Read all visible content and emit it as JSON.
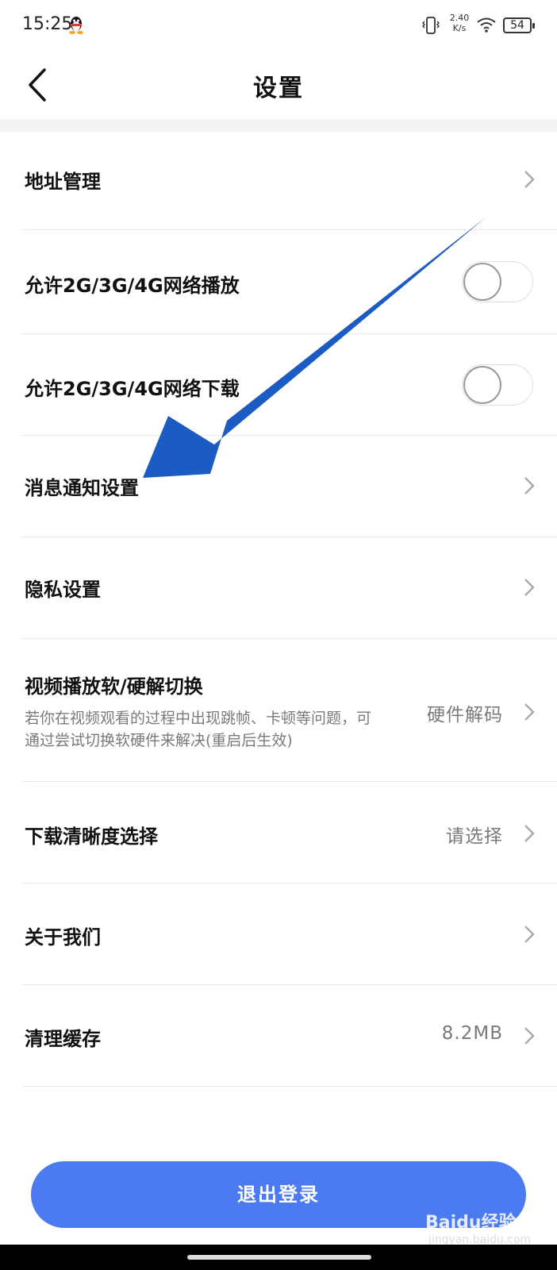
{
  "status_bar": {
    "time": "15:25",
    "net_speed_value": "2.40",
    "net_speed_unit": "K/s",
    "battery": "54"
  },
  "header": {
    "title": "设置"
  },
  "rows": {
    "address": {
      "label": "地址管理"
    },
    "play_mobile": {
      "label": "允许2G/3G/4G网络播放",
      "toggle_on": false
    },
    "download_mobile": {
      "label": "允许2G/3G/4G网络下载",
      "toggle_on": false
    },
    "notification": {
      "label": "消息通知设置"
    },
    "privacy": {
      "label": "隐私设置"
    },
    "decode": {
      "label": "视频播放软/硬解切换",
      "desc": "若你在视频观看的过程中出现跳帧、卡顿等问题，可通过尝试切换软硬件来解决(重启后生效)",
      "value": "硬件解码"
    },
    "download_quality": {
      "label": "下载清晰度选择",
      "value": "请选择"
    },
    "about": {
      "label": "关于我们"
    },
    "cache": {
      "label": "清理缓存",
      "value": "8.2MB"
    }
  },
  "logout": {
    "label": "退出登录"
  },
  "watermark": {
    "logo": "Baidu经验",
    "url": "jingyan.baidu.com"
  },
  "colors": {
    "accent": "#4c7bf1",
    "annotation_arrow": "#1b5bc3"
  }
}
